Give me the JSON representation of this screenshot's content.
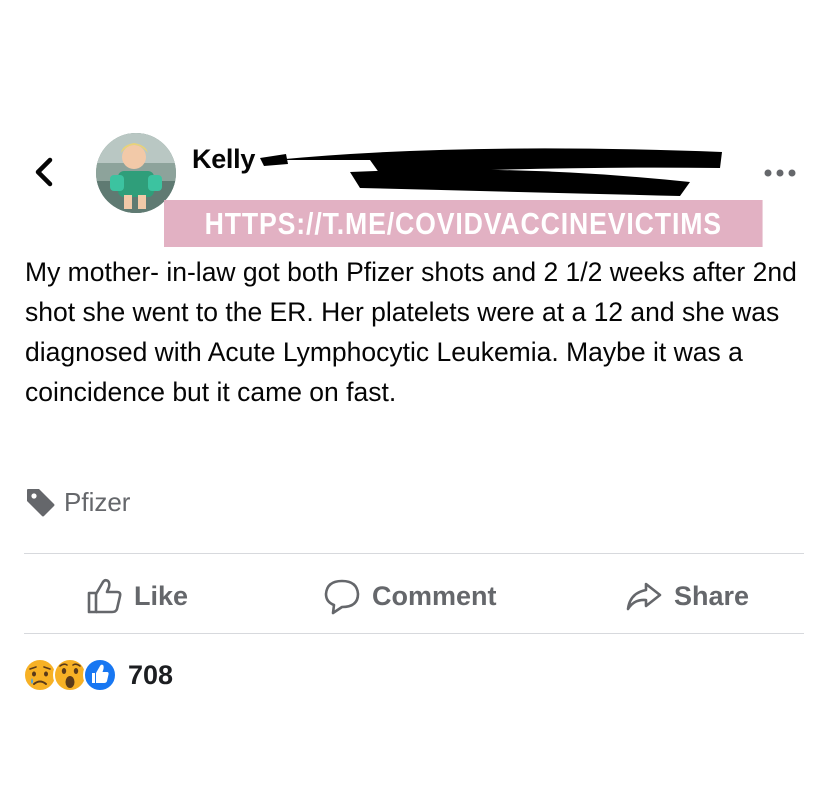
{
  "post": {
    "author_name": "Kelly",
    "watermark": "HTTPS://T.ME/COVIDVACCINEVICTIMS",
    "body": "My mother- in-law got both Pfizer shots and 2 1/2 weeks after 2nd shot she went to the ER. Her platelets were at a 12 and she was diagnosed with Acute Lymphocytic Leukemia. Maybe it was a coincidence but it came on fast.",
    "tag": "Pfizer"
  },
  "actions": {
    "like": "Like",
    "comment": "Comment",
    "share": "Share"
  },
  "reactions": {
    "icons": [
      "sad-reaction-icon",
      "wow-reaction-icon",
      "like-reaction-icon"
    ],
    "count": "708"
  },
  "colors": {
    "secondary_text": "#65676b",
    "like_blue": "#1877f2",
    "reaction_yellow": "#f7b125",
    "watermark_bg": "#e0aabe"
  }
}
